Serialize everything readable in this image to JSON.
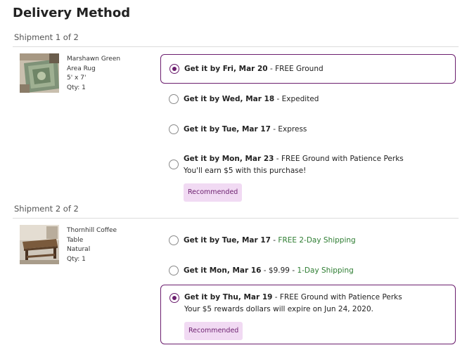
{
  "page": {
    "title": "Delivery Method"
  },
  "shipments": [
    {
      "label": "Shipment 1 of 2",
      "product": {
        "name_line1": "Marshawn Green",
        "name_line2": "Area Rug",
        "size": "5' x 7'",
        "qty": "Qty: 1"
      },
      "options": [
        {
          "date": "Get it by Fri, Mar 20",
          "sep": " - ",
          "method": "FREE Ground",
          "selected": true
        },
        {
          "date": "Get it by Wed, Mar 18",
          "sep": " - ",
          "method": "Expedited",
          "selected": false
        },
        {
          "date": "Get it by Tue, Mar 17",
          "sep": " - ",
          "method": "Express",
          "selected": false
        },
        {
          "date": "Get it by Mon, Mar 23",
          "sep": " - ",
          "method": "FREE Ground with Patience Perks",
          "note": "You'll earn $5 with this purchase!",
          "badge": "Recommended",
          "selected": false
        }
      ]
    },
    {
      "label": "Shipment 2 of 2",
      "product": {
        "name_line1": "Thornhill Coffee",
        "name_line2": "Table",
        "finish": "Natural",
        "qty": "Qty: 1"
      },
      "options": [
        {
          "date": "Get it by Tue, Mar 17",
          "sep": " - ",
          "method": "FREE 2-Day Shipping",
          "selected": false
        },
        {
          "date": "Get it Mon, Mar 16",
          "sep": " - $9.99 - ",
          "method": "1-Day Shipping",
          "selected": false
        },
        {
          "date": "Get it by Thu, Mar 19",
          "sep": " - ",
          "method": "FREE Ground with Patience Perks",
          "note": "Your $5 rewards dollars will expire on Jun 24, 2020.",
          "badge": "Recommended",
          "selected": true
        }
      ]
    }
  ],
  "colors": {
    "accent": "#6b1e6e",
    "badge_bg": "#f1daf3",
    "green": "#2e7d32",
    "divider": "#dcdcdc"
  },
  "icons": {
    "product_1": "area-rug-thumbnail",
    "product_2": "coffee-table-thumbnail"
  }
}
